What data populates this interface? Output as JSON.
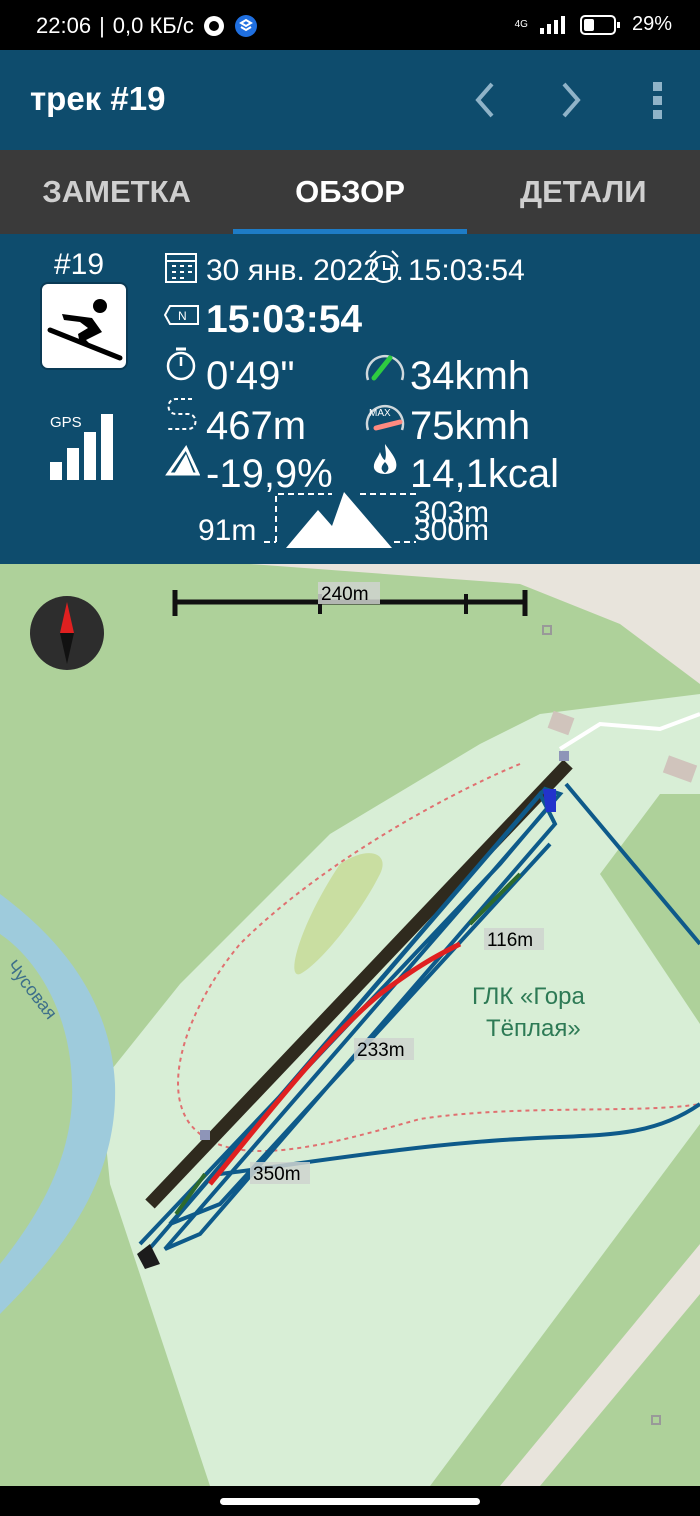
{
  "status_bar": {
    "time": "22:06",
    "net_speed": "0,0 КБ/с",
    "network": "4G",
    "battery": "29%"
  },
  "app_bar": {
    "title": "трек #19",
    "prev_icon": "chevron-left-icon",
    "next_icon": "chevron-right-icon",
    "menu_icon": "more-vert-icon"
  },
  "tabs": [
    {
      "label": "ЗАМЕТКА",
      "active": false
    },
    {
      "label": "ОБЗОР",
      "active": true
    },
    {
      "label": "ДЕТАЛИ",
      "active": false
    }
  ],
  "track": {
    "number": "#19",
    "activity_icon": "skiing-icon",
    "gps_label": "GPS",
    "date": "30 янв. 2022 г.",
    "alarm_time": "15:03:54",
    "start_time": "15:03:54",
    "duration": "0'49\"",
    "avg_speed": "34kmh",
    "distance": "467m",
    "max_speed": "75kmh",
    "max_label": "MAX",
    "slope": "-19,9%",
    "calories": "14,1kcal",
    "min_alt": "91m",
    "alt_a": "303m",
    "alt_b": "300m"
  },
  "map": {
    "scale_label": "240m",
    "river_label": "Чусовая",
    "place_label_1": "ГЛК «Гора",
    "place_label_2": "Тёплая»",
    "markers": [
      "116m",
      "233m",
      "350m"
    ],
    "colors": {
      "track": "#0e5a8a",
      "fast": "#e02020",
      "lift": "#2f2a1e",
      "land": "#aed19a",
      "slope": "#d8eed6",
      "river": "#9ecbdc"
    }
  }
}
